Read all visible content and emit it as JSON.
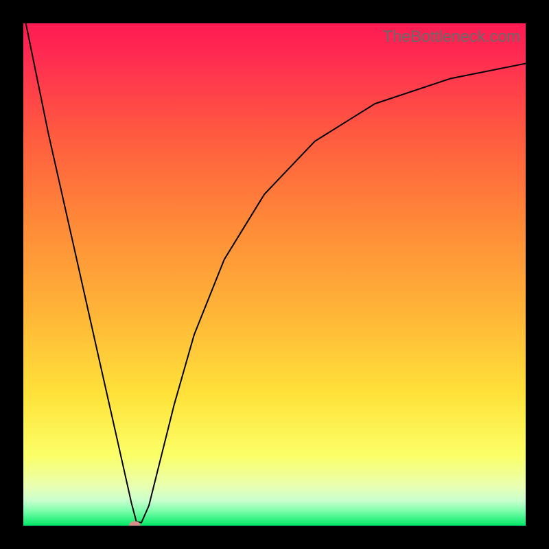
{
  "attribution": "TheBottleneck.com",
  "chart_data": {
    "type": "line",
    "title": "",
    "xlabel": "",
    "ylabel": "",
    "xlim": [
      0,
      100
    ],
    "ylim": [
      0,
      100
    ],
    "gradient_colors": {
      "top": "#ff1a52",
      "orange": "#ff7a3a",
      "yellow": "#ffe43a",
      "pale": "#f5ffb7",
      "green": "#00e866"
    },
    "series": [
      {
        "name": "curve",
        "x": [
          0.5,
          5,
          10,
          15,
          18,
          20,
          21.5,
          22.5,
          23.5,
          25,
          27,
          30,
          34,
          40,
          48,
          58,
          70,
          85,
          100
        ],
        "y": [
          100,
          78,
          55.8,
          33.5,
          20.2,
          11.3,
          4.6,
          0.8,
          0.6,
          4.0,
          12.0,
          24.0,
          38.0,
          53.0,
          66.0,
          76.5,
          84.0,
          89.0,
          92.0
        ]
      }
    ],
    "marker": {
      "x": 22.2,
      "y": 0.15,
      "color": "#d98d88"
    }
  }
}
